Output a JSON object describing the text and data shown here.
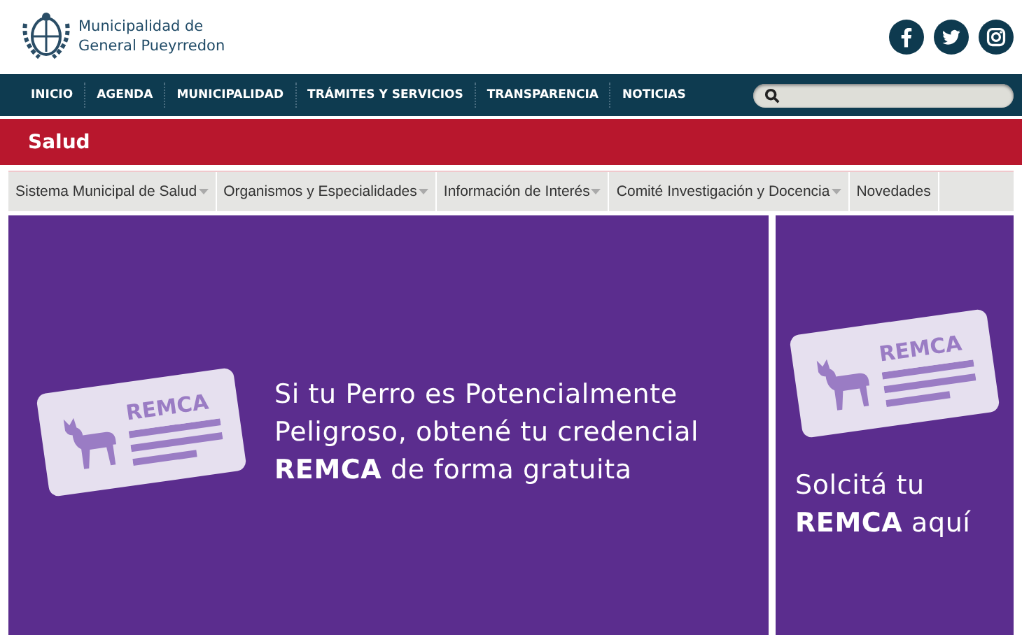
{
  "header": {
    "site_name_line1": "Municipalidad de",
    "site_name_line2": "General Pueyrredon"
  },
  "nav": {
    "items": [
      {
        "label": "INICIO"
      },
      {
        "label": "AGENDA"
      },
      {
        "label": "MUNICIPALIDAD"
      },
      {
        "label": "TRÁMITES Y SERVICIOS"
      },
      {
        "label": "TRANSPARENCIA"
      },
      {
        "label": "NOTICIAS"
      }
    ]
  },
  "section_title": "Salud",
  "subnav": {
    "items": [
      {
        "label": "Sistema Municipal de Salud",
        "dropdown": true
      },
      {
        "label": "Organismos y Especialidades",
        "dropdown": true
      },
      {
        "label": "Información de Interés",
        "dropdown": true
      },
      {
        "label": "Comité Investigación y Docencia",
        "dropdown": true
      },
      {
        "label": "Novedades",
        "dropdown": false
      }
    ]
  },
  "banners": [
    {
      "card_label": "REMCA",
      "text": "Si tu Perro es Potencialmente Peligroso, obtené tu credencial **REMCA** de forma gratuita"
    },
    {
      "card_label": "REMCA",
      "text": "Solcitá tu **REMCA** aquí"
    }
  ]
}
